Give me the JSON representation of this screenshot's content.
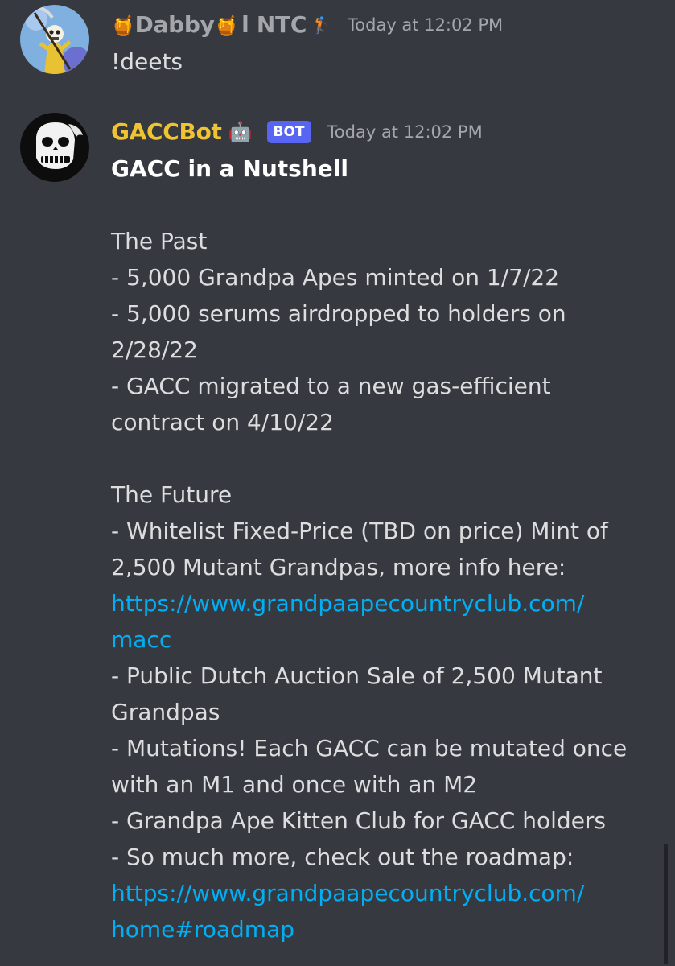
{
  "messages": [
    {
      "username_prefix_emoji": "🍯",
      "username_text": "Dabby",
      "username_mid_emoji": "🍯",
      "username_suffix": "l NTC",
      "badge_emoji": "🏌",
      "name_color": "#a3a6aa",
      "avatar_icon": "skeleton-reaper-avatar",
      "timestamp": "Today at 12:02 PM",
      "text": "!deets"
    },
    {
      "username": "GACCBot",
      "username_emoji": "🤖",
      "name_color": "#f0c330",
      "bot_tag": "BOT",
      "avatar_icon": "ape-skull-avatar",
      "timestamp": "Today at 12:02 PM",
      "title": "GACC in a Nutshell",
      "lines": [
        "The Past",
        "- 5,000 Grandpa Apes minted on 1/7/22",
        "- 5,000 serums airdropped to holders on",
        "2/28/22",
        "- GACC migrated to a new gas-efficient",
        "contract on 4/10/22",
        "The Future",
        "- Whitelist Fixed-Price (TBD on price) Mint of",
        "2,500 Mutant Grandpas, more info here:",
        "https://www.grandpaapecountryclub.com/",
        "macc",
        "- Public Dutch Auction Sale of 2,500 Mutant",
        "Grandpas",
        "- Mutations! Each GACC can be mutated once",
        "with an M1 and once with an M2",
        "- Grandpa Ape Kitten Club for GACC holders",
        "- So much more, check out the roadmap:",
        "https://www.grandpaapecountryclub.com/",
        "home#roadmap"
      ]
    }
  ],
  "colors": {
    "background": "#36393f",
    "text": "#dcddde",
    "link": "#00aff4",
    "bot_tag": "#5865f2",
    "timestamp": "#a3a6aa"
  }
}
